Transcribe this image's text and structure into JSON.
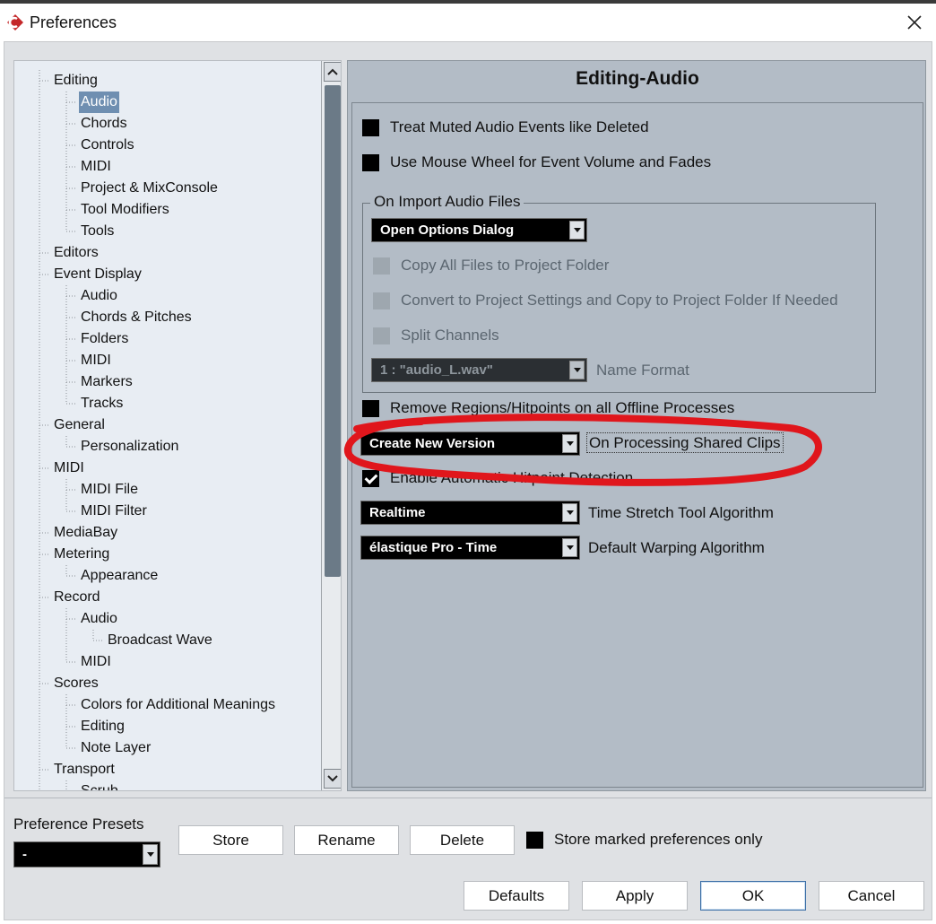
{
  "window": {
    "title": "Preferences",
    "close_glyph": "✕"
  },
  "tree": {
    "items": [
      {
        "label": "Editing",
        "level": 1
      },
      {
        "label": "Audio",
        "level": 2,
        "selected": true
      },
      {
        "label": "Chords",
        "level": 2
      },
      {
        "label": "Controls",
        "level": 2
      },
      {
        "label": "MIDI",
        "level": 2
      },
      {
        "label": "Project & MixConsole",
        "level": 2
      },
      {
        "label": "Tool Modifiers",
        "level": 2
      },
      {
        "label": "Tools",
        "level": 2
      },
      {
        "label": "Editors",
        "level": 1
      },
      {
        "label": "Event Display",
        "level": 1
      },
      {
        "label": "Audio",
        "level": 2
      },
      {
        "label": "Chords & Pitches",
        "level": 2
      },
      {
        "label": "Folders",
        "level": 2
      },
      {
        "label": "MIDI",
        "level": 2
      },
      {
        "label": "Markers",
        "level": 2
      },
      {
        "label": "Tracks",
        "level": 2
      },
      {
        "label": "General",
        "level": 1
      },
      {
        "label": "Personalization",
        "level": 2
      },
      {
        "label": "MIDI",
        "level": 1
      },
      {
        "label": "MIDI File",
        "level": 2
      },
      {
        "label": "MIDI Filter",
        "level": 2
      },
      {
        "label": "MediaBay",
        "level": 1
      },
      {
        "label": "Metering",
        "level": 1
      },
      {
        "label": "Appearance",
        "level": 2
      },
      {
        "label": "Record",
        "level": 1
      },
      {
        "label": "Audio",
        "level": 2
      },
      {
        "label": "Broadcast Wave",
        "level": 3
      },
      {
        "label": "MIDI",
        "level": 2
      },
      {
        "label": "Scores",
        "level": 1
      },
      {
        "label": "Colors for Additional Meanings",
        "level": 2
      },
      {
        "label": "Editing",
        "level": 2
      },
      {
        "label": "Note Layer",
        "level": 2
      },
      {
        "label": "Transport",
        "level": 1
      },
      {
        "label": "Scrub",
        "level": 2
      }
    ]
  },
  "panel": {
    "title": "Editing-Audio",
    "treat_muted_label": "Treat Muted Audio Events like Deleted",
    "mouse_wheel_label": "Use Mouse Wheel for Event Volume and Fades",
    "import_group_title": "On Import Audio Files",
    "import_dropdown_value": "Open Options Dialog",
    "copy_files_label": "Copy All Files to Project Folder",
    "convert_label": "Convert to Project Settings and Copy to Project Folder If Needed",
    "split_channels_label": "Split Channels",
    "name_format_value": "1 : \"audio_L.wav\"",
    "name_format_label": "Name Format",
    "remove_regions_label": "Remove Regions/Hitpoints on all Offline Processes",
    "shared_clips_value": "Create New Version",
    "shared_clips_label": "On Processing Shared Clips",
    "hitpoint_label": "Enable Automatic Hitpoint Detection",
    "time_stretch_value": "Realtime",
    "time_stretch_label": "Time Stretch Tool Algorithm",
    "warp_value": "élastique Pro - Time",
    "warp_label": "Default Warping Algorithm"
  },
  "annotation_color": "#e0161c",
  "bottom": {
    "presets_label": "Preference Presets",
    "presets_value": "-",
    "store_label": "Store",
    "rename_label": "Rename",
    "delete_label": "Delete",
    "store_marked_label": "Store marked preferences only",
    "defaults_label": "Defaults",
    "apply_label": "Apply",
    "ok_label": "OK",
    "cancel_label": "Cancel"
  }
}
